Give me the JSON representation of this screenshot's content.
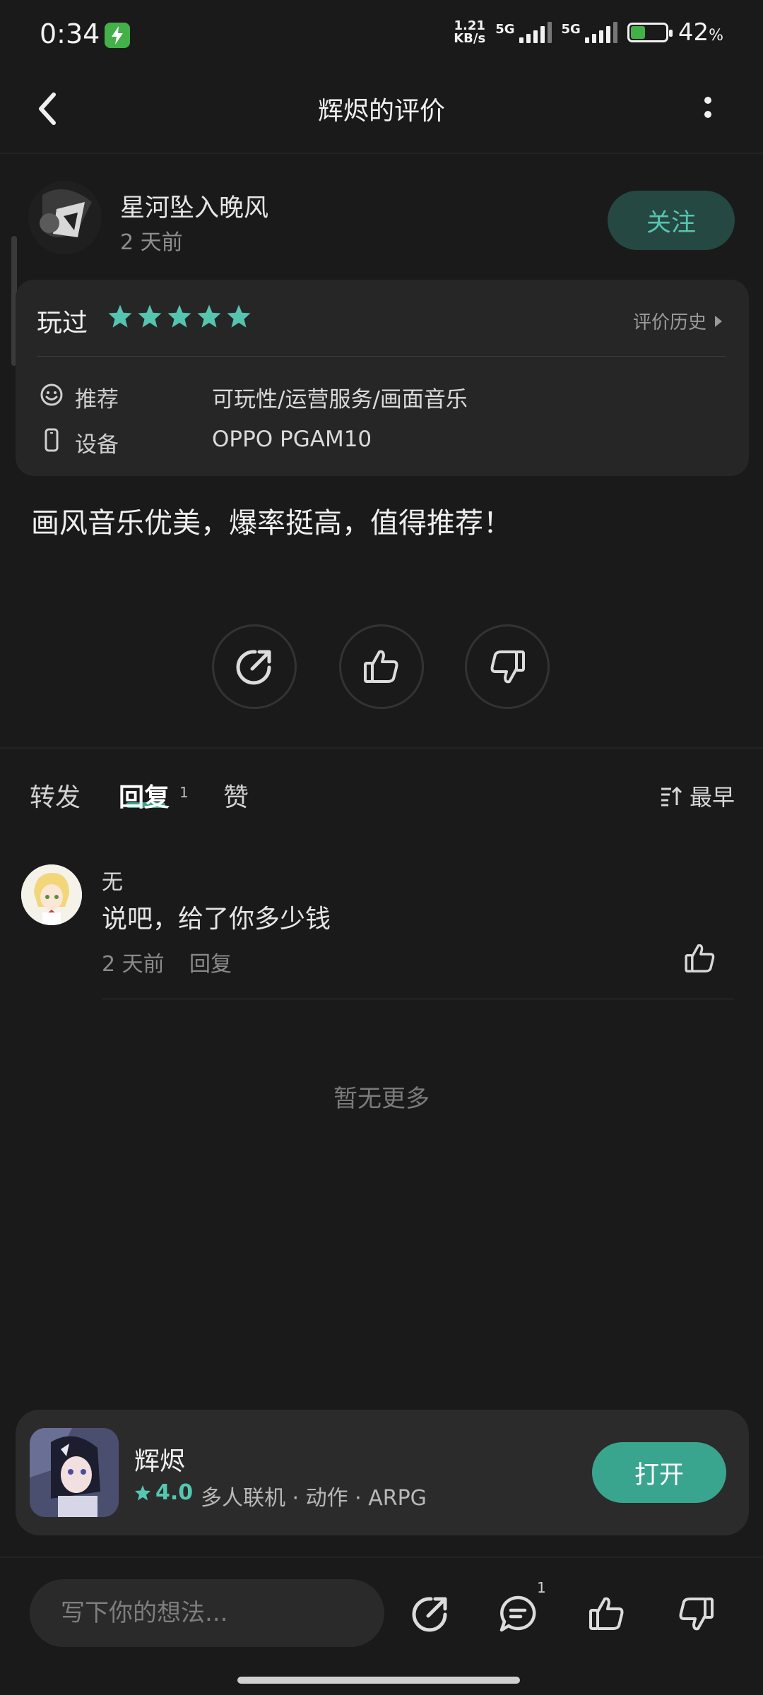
{
  "status_bar": {
    "time": "0:34",
    "net_speed_value": "1.21",
    "net_speed_unit": "KB/s",
    "sim1": "5G",
    "sim2": "5G",
    "battery": "42",
    "battery_unit": "%",
    "battery_level": 0.42
  },
  "header": {
    "title": "辉烬的评价"
  },
  "reviewer": {
    "name": "星河坠入晚风",
    "time": "2 天前",
    "follow_label": "关注"
  },
  "review_card": {
    "status": "玩过",
    "stars": 5,
    "history_label": "评价历史",
    "recommend_label": "推荐",
    "recommend_value": "可玩性/运营服务/画面音乐",
    "device_label": "设备",
    "device_value": "OPPO PGAM10"
  },
  "review_text": "画风音乐优美，爆率挺高，值得推荐！",
  "tabs": {
    "forward": "转发",
    "reply": "回复",
    "reply_count": "1",
    "like": "赞",
    "sort_label": "最早"
  },
  "comments": [
    {
      "name": "无",
      "text": "说吧，给了你多少钱",
      "time": "2 天前",
      "reply_label": "回复"
    }
  ],
  "no_more": "暂无更多",
  "game": {
    "name": "辉烬",
    "rating": "4.0",
    "tags": "多人联机 · 动作 · ARPG",
    "open_label": "打开"
  },
  "bottom_bar": {
    "input_placeholder": "写下你的想法...",
    "comment_count": "1"
  },
  "colors": {
    "accent": "#3aa58f",
    "accent_text": "#57c4b0",
    "background": "#1a1a1a",
    "card": "#262626"
  }
}
